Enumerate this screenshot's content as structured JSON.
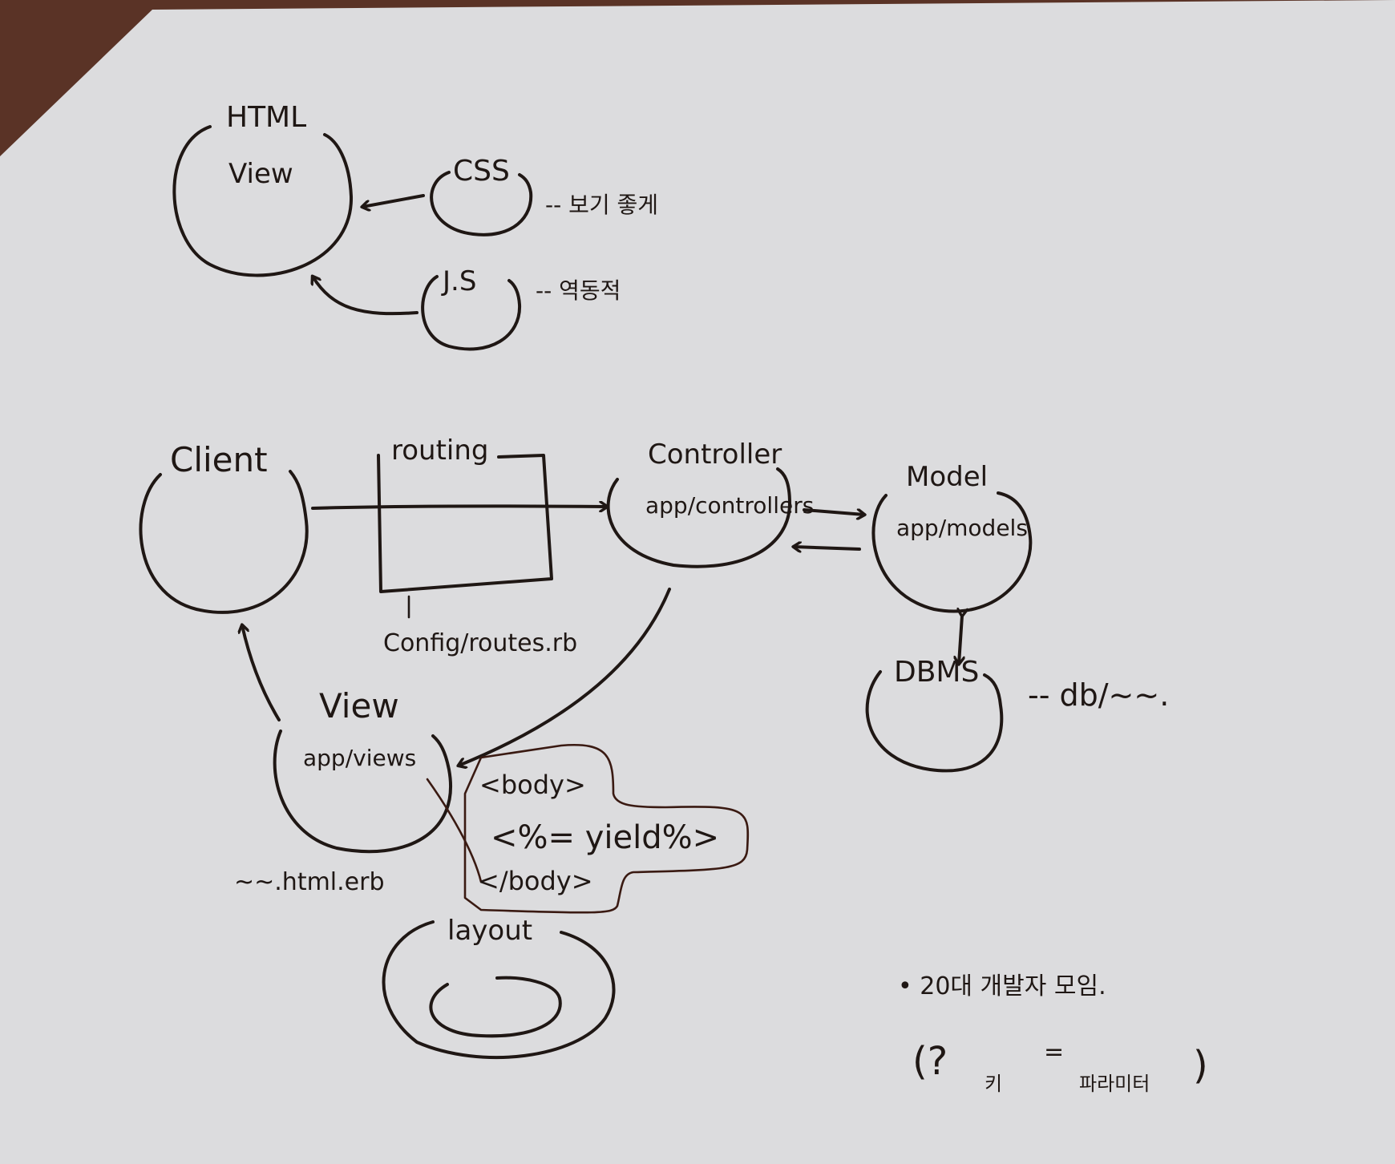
{
  "colors": {
    "paper": "#dcdcde",
    "ink": "#1f1714",
    "background": "#5a3326"
  },
  "top": {
    "html_label": "HTML",
    "view_label": "View",
    "css_label": "CSS",
    "css_note": "-- 보기 좋게",
    "js_label": "J.S",
    "js_note": "-- 역동적"
  },
  "flow": {
    "client_label": "Client",
    "routing_label": "routing",
    "routing_path": "Config/routes.rb",
    "controller_label": "Controller",
    "controller_path": "app/controllers",
    "model_label": "Model",
    "model_path": "app/models",
    "dbms_label": "DBMS",
    "dbms_note": "-- db/~~.",
    "view_label": "View",
    "view_path": "app/views",
    "view_file": "~~.html.erb",
    "layout_label": "layout",
    "layout_body_open": "<body>",
    "layout_yield": "<%= yield%>",
    "layout_body_close": "</body>"
  },
  "notes": {
    "meetup": "• 20대 개발자 모임.",
    "paren_open": "(?",
    "key": "키",
    "equals": "=",
    "value": "파라미터",
    "paren_close": ")"
  }
}
